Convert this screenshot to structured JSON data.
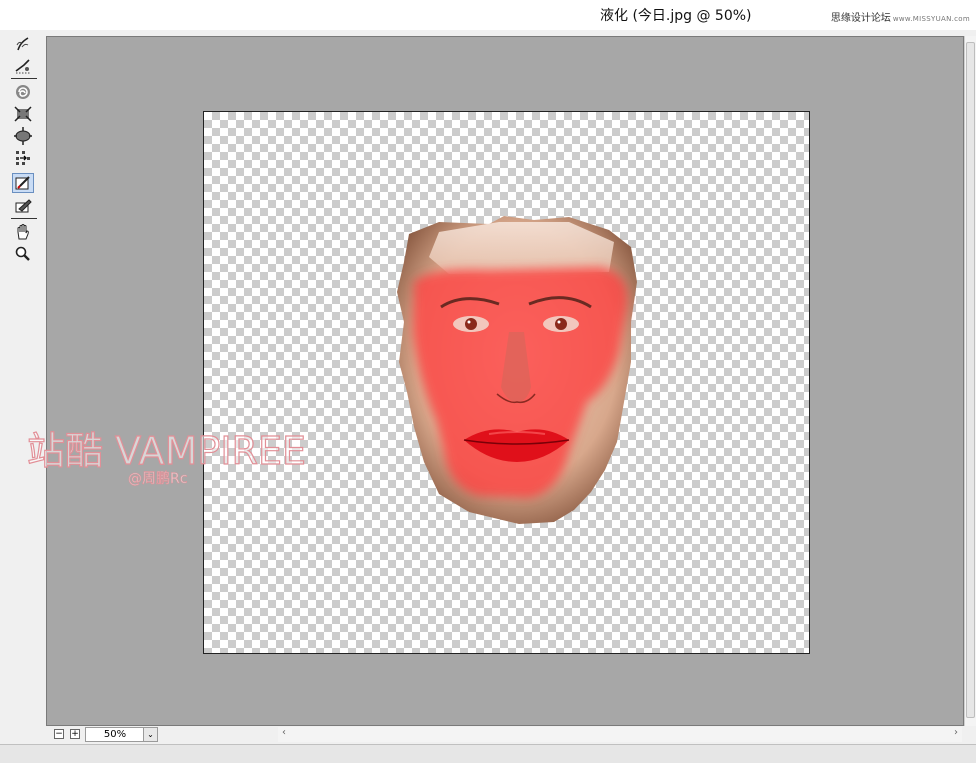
{
  "window": {
    "title": "液化 (今日.jpg @ 50%)",
    "site_watermark": "思缘设计论坛",
    "site_url": "www.MISSYUAN.com"
  },
  "toolbar": {
    "tools": [
      {
        "name": "forward-warp-tool-icon"
      },
      {
        "name": "reconstruct-tool-icon"
      },
      {
        "name": "twirl-tool-icon"
      },
      {
        "name": "pucker-tool-icon"
      },
      {
        "name": "bloat-tool-icon"
      },
      {
        "name": "push-left-tool-icon"
      },
      {
        "name": "freeze-mask-tool-icon",
        "active": true
      },
      {
        "name": "thaw-mask-tool-icon"
      },
      {
        "name": "hand-tool-icon"
      },
      {
        "name": "zoom-tool-icon"
      }
    ]
  },
  "overlay": {
    "watermark_main": "站酷 VAMPIREE",
    "watermark_author": "@周鹏Rc"
  },
  "statusbar": {
    "zoom_out": "−",
    "zoom_in": "+",
    "zoom_value": "50%",
    "dropdown": "⌄"
  },
  "colors": {
    "canvas_bg": "#a7a7a7",
    "mask": "#ff3b3b",
    "active_tool": "#c9dcf5"
  }
}
